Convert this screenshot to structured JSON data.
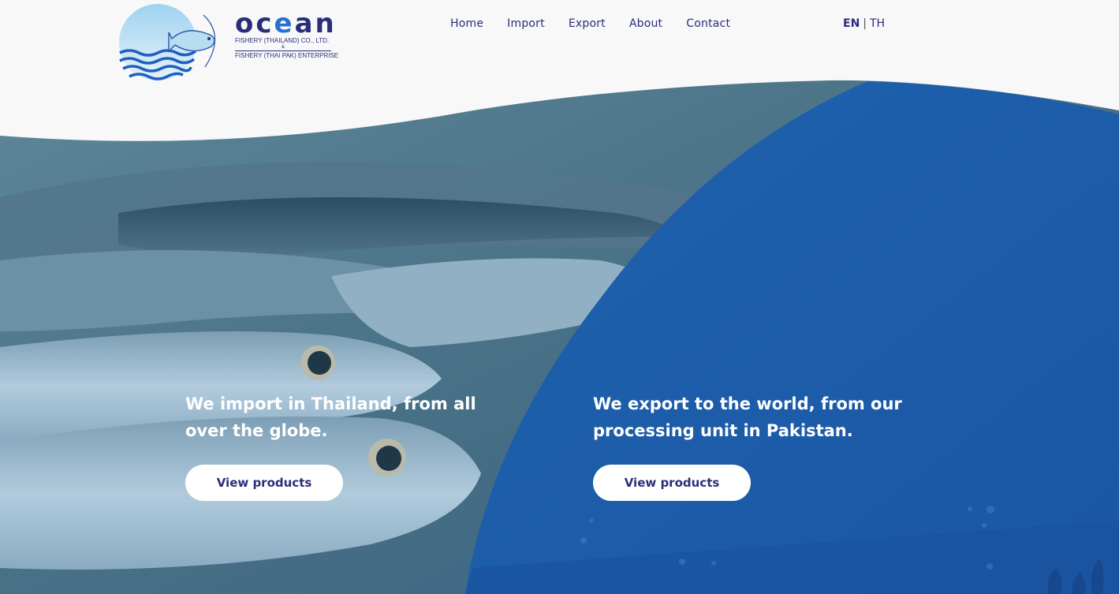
{
  "logo": {
    "word_pre": "oc",
    "word_e": "e",
    "word_post": "an",
    "line1": "FISHERY (THAILAND) CO., LTD.",
    "amp": "&",
    "line2": "FISHERY (THAI PAK) ENTERPRISE"
  },
  "nav": {
    "items": [
      {
        "label": "Home"
      },
      {
        "label": "Import"
      },
      {
        "label": "Export"
      },
      {
        "label": "About"
      },
      {
        "label": "Contact"
      }
    ]
  },
  "lang": {
    "en": "EN",
    "separator": "|",
    "th": "TH"
  },
  "import_panel": {
    "headline": "We import in Thailand, from all over the globe.",
    "button": "View products"
  },
  "export_panel": {
    "headline": "We export to the world, from our processing unit in Pakistan.",
    "button": "View products"
  },
  "colors": {
    "brand_navy": "#2b2d7a",
    "brand_blue": "#1f5fae",
    "background": "#f8f8f9"
  }
}
